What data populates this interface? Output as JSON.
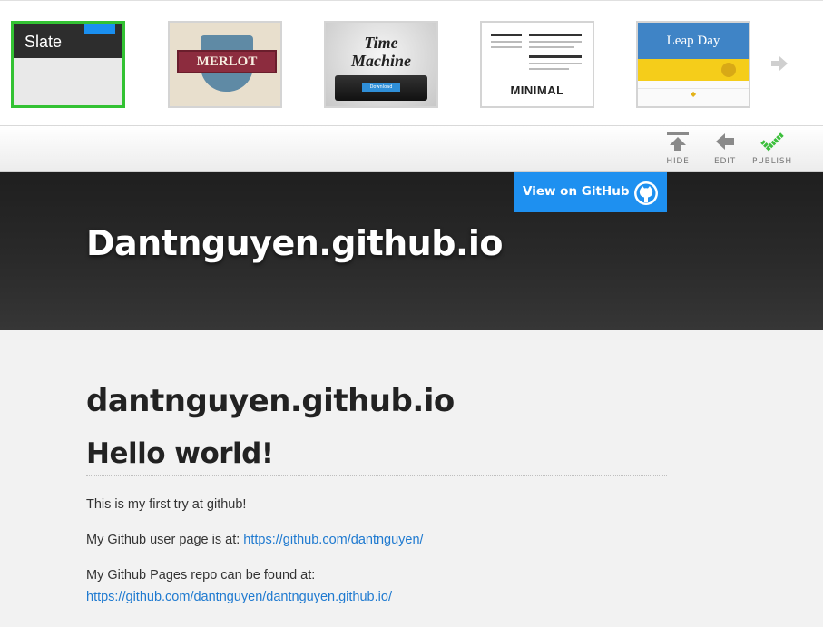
{
  "themes": {
    "slate": {
      "name": "Slate",
      "selected": true
    },
    "merlot": {
      "name": "MERLOT"
    },
    "time_machine": {
      "line1": "Time",
      "line2": "Machine",
      "download": "Download"
    },
    "minimal": {
      "name": "MINIMAL"
    },
    "leap_day": {
      "name": "Leap Day"
    },
    "next_icon": "arrow-right-icon"
  },
  "toolbar": {
    "hide_label": "HIDE",
    "edit_label": "EDIT",
    "publish_label": "PUBLISH"
  },
  "header": {
    "site_title": "Dantnguyen.github.io",
    "github_button": "View on GitHub"
  },
  "content": {
    "h1": "dantnguyen.github.io",
    "h2": "Hello world!",
    "p1": "This is my first try at github!",
    "p2_text": "My Github user page is at: ",
    "p2_link": "https://github.com/dantnguyen/",
    "p3_text": "My Github Pages repo can be found at:",
    "p3_link": "https://github.com/dantnguyen/dantnguyen.github.io/"
  },
  "colors": {
    "selected_border": "#33c233",
    "github_button": "#1e90f0",
    "link": "#1f7ad0",
    "header_bg": "#2b2b2b",
    "publish_check": "#3cbf3c"
  }
}
